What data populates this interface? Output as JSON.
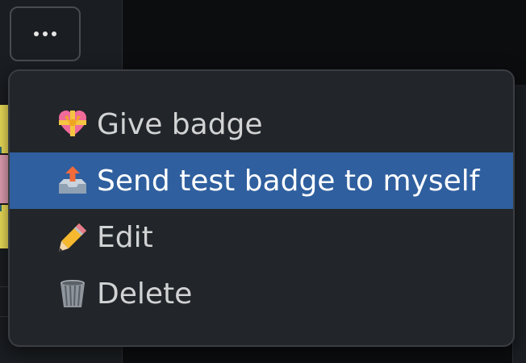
{
  "more_button": {
    "icon": "ellipsis-icon"
  },
  "menu": {
    "items": [
      {
        "label": "Give badge",
        "icon": "heart-ribbon-icon",
        "highlighted": false
      },
      {
        "label": "Send test badge to myself",
        "icon": "outbox-tray-icon",
        "highlighted": true
      },
      {
        "label": "Edit",
        "icon": "pencil-icon",
        "highlighted": false
      },
      {
        "label": "Delete",
        "icon": "wastebasket-icon",
        "highlighted": false
      }
    ]
  },
  "colors": {
    "highlight": "#2f5f9e",
    "menu_background": "#222529",
    "text": "#d1d2d3"
  }
}
